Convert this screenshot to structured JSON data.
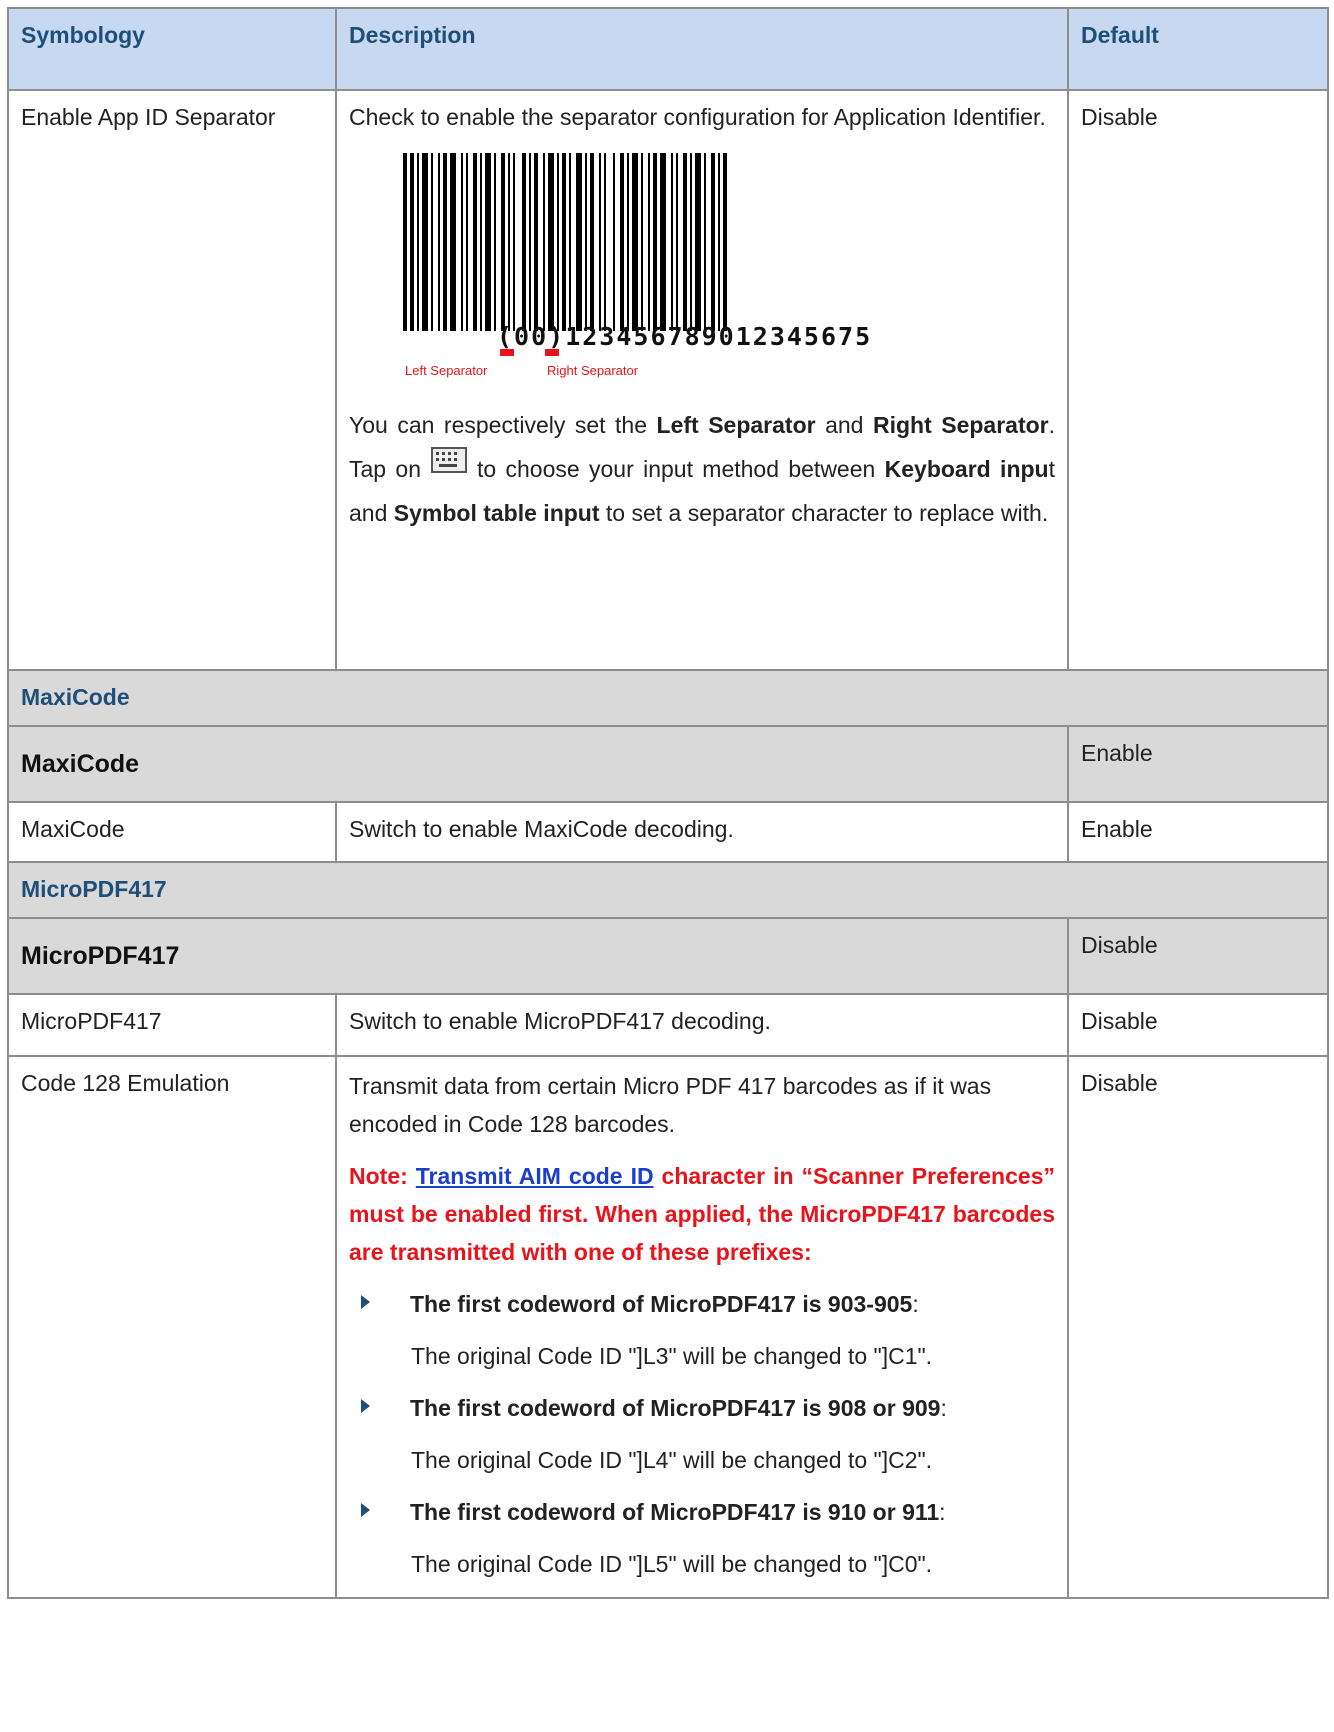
{
  "table": {
    "headers": {
      "symbology": "Symbology",
      "description": "Description",
      "default": "Default"
    },
    "app_id_row": {
      "symbology": "Enable App ID Separator",
      "desc_intro": "Check to enable the separator configuration for Application Identifier.",
      "barcode": {
        "digits": "(00)123456789012345675",
        "left_label": "Left Separator",
        "right_label": "Right Separator"
      },
      "desc_p2": {
        "t1": "You can respectively set the ",
        "b1": "Left Separator",
        "t2": " and ",
        "b2": "Right Separator",
        "t3": ". Tap on",
        "icon": "keyboard-icon",
        "t4": "to choose your input method between ",
        "b3": "Keyboard inpu",
        "t5": "t and ",
        "b4": "Symbol table input",
        "t6": " to set a separator character to replace with."
      },
      "default": "Disable"
    },
    "maxicode_group": {
      "title": "MaxiCode",
      "sub_title": "MaxiCode",
      "sub_default": "Enable",
      "row": {
        "symbology": "MaxiCode",
        "description": "Switch to enable MaxiCode decoding.",
        "default": "Enable"
      }
    },
    "micropdf_group": {
      "title": "MicroPDF417",
      "sub_title": "MicroPDF417",
      "sub_default": "Disable",
      "row": {
        "symbology": "MicroPDF417",
        "description": "Switch to enable MicroPDF417 decoding.",
        "default": "Disable"
      }
    },
    "code128_row": {
      "symbology": "Code 128 Emulation",
      "description": "Transmit data from certain Micro PDF 417 barcodes as if it was encoded in Code 128 barcodes.",
      "note_prefix": "Note: ",
      "note_link": "Transmit AIM code ID",
      "note_rest": " character in “Scanner Preferences” must be enabled first. When applied, the MicroPDF417 barcodes are transmitted with one of these prefixes:",
      "bullets": [
        {
          "title": "The first codeword of MicroPDF417 is 903-905",
          "colon": ":",
          "detail": "The original Code ID \"]L3\" will be changed to \"]C1\"."
        },
        {
          "title": "The first codeword of MicroPDF417 is 908 or 909",
          "colon": ":",
          "detail": "The original Code ID \"]L4\" will be changed to \"]C2\"."
        },
        {
          "title": "The first codeword of MicroPDF417 is 910 or 911",
          "colon": ":",
          "detail": "The original Code ID \"]L5\" will be changed to \"]C0\"."
        }
      ],
      "default": "Disable"
    }
  }
}
